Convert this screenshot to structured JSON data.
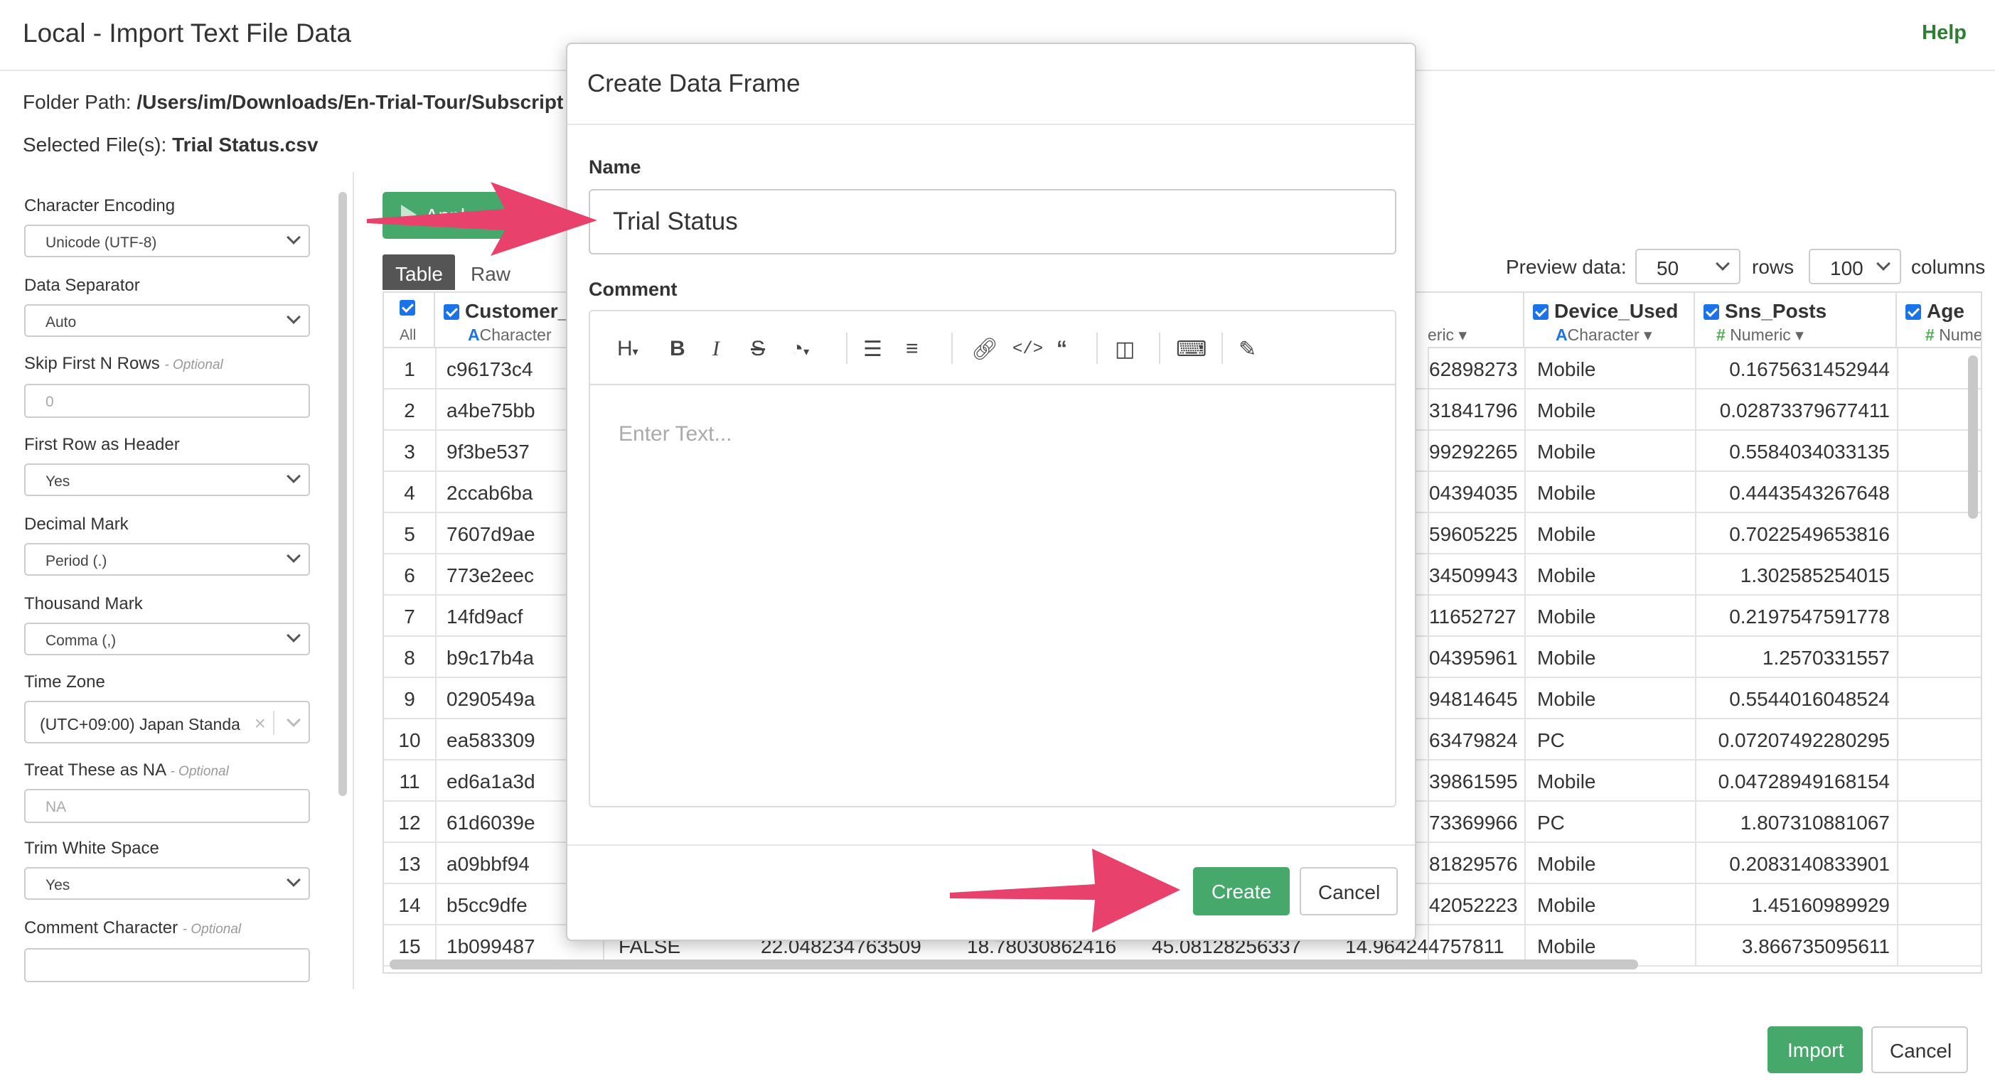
{
  "header": {
    "title": "Local - Import Text File Data",
    "help": "Help"
  },
  "paths": {
    "folder_label": "Folder Path:",
    "folder_value": "/Users/im/Downloads/En-Trial-Tour/Subscript",
    "file_label": "Selected File(s):",
    "file_value": "Trial Status.csv"
  },
  "sidebar": {
    "encoding_label": "Character Encoding",
    "encoding_value": "Unicode (UTF-8)",
    "separator_label": "Data Separator",
    "separator_value": "Auto",
    "skip_label": "Skip First N Rows",
    "skip_optional": "- Optional",
    "skip_placeholder": "0",
    "header_label": "First Row as Header",
    "header_value": "Yes",
    "decimal_label": "Decimal Mark",
    "decimal_value": "Period (.)",
    "thousand_label": "Thousand Mark",
    "thousand_value": "Comma (,)",
    "tz_label": "Time Zone",
    "tz_value": "(UTC+09:00) Japan Standa",
    "na_label": "Treat These as NA",
    "na_optional": "- Optional",
    "na_placeholder": "NA",
    "trim_label": "Trim White Space",
    "trim_value": "Yes",
    "comment_label": "Comment Character",
    "comment_optional": "- Optional"
  },
  "main": {
    "apply_label": "Apply",
    "tabs": [
      "Table",
      "Raw"
    ],
    "preview_label": "Preview data:",
    "preview_rows": "50",
    "rows_label": "rows",
    "preview_cols": "100",
    "cols_label": "columns"
  },
  "grid": {
    "all_label": "All",
    "columns": [
      {
        "name": "Customer_",
        "type": "Character",
        "type_icon": "A"
      },
      {
        "name": "Device_Used",
        "type": "Character",
        "type_icon": "A"
      },
      {
        "name": "Sns_Posts",
        "type": "Numeric",
        "type_icon": "#"
      },
      {
        "name": "Age",
        "type": "Nume",
        "type_icon": "#"
      }
    ],
    "partial_type": "eric",
    "rows": [
      {
        "n": "1",
        "id": "c96173c4",
        "num": "62898273",
        "device": "Mobile",
        "sns": "0.1675631452944"
      },
      {
        "n": "2",
        "id": "a4be75bb",
        "num": "31841796",
        "device": "Mobile",
        "sns": "0.02873379677411"
      },
      {
        "n": "3",
        "id": "9f3be537",
        "num": "99292265",
        "device": "Mobile",
        "sns": "0.5584034033135"
      },
      {
        "n": "4",
        "id": "2ccab6ba",
        "num": "04394035",
        "device": "Mobile",
        "sns": "0.4443543267648"
      },
      {
        "n": "5",
        "id": "7607d9ae",
        "num": "59605225",
        "device": "Mobile",
        "sns": "0.7022549653816"
      },
      {
        "n": "6",
        "id": "773e2eec",
        "num": "34509943",
        "device": "Mobile",
        "sns": "1.302585254015"
      },
      {
        "n": "7",
        "id": "14fd9acf",
        "num": "11652727",
        "device": "Mobile",
        "sns": "0.2197547591778"
      },
      {
        "n": "8",
        "id": "b9c17b4a",
        "num": "04395961",
        "device": "Mobile",
        "sns": "1.2570331557"
      },
      {
        "n": "9",
        "id": "0290549a",
        "num": "94814645",
        "device": "Mobile",
        "sns": "0.5544016048524"
      },
      {
        "n": "10",
        "id": "ea583309",
        "num": "63479824",
        "device": "PC",
        "sns": "0.07207492280295"
      },
      {
        "n": "11",
        "id": "ed6a1a3d",
        "num": "39861595",
        "device": "Mobile",
        "sns": "0.04728949168154"
      },
      {
        "n": "12",
        "id": "61d6039e",
        "num": "73369966",
        "device": "PC",
        "sns": "1.807310881067"
      },
      {
        "n": "13",
        "id": "a09bbf94",
        "num": "81829576",
        "device": "Mobile",
        "sns": "0.2083140833901"
      },
      {
        "n": "14",
        "id": "b5cc9dfe",
        "num": "42052223",
        "device": "Mobile",
        "sns": "1.45160989929"
      }
    ],
    "last_row": {
      "n": "15",
      "id": "1b099487",
      "bool": "FALSE",
      "v1": "22.048234763509",
      "v2": "18.78030862416",
      "v3": "45.08128256337",
      "num": "14.964244757811",
      "device": "Mobile",
      "sns": "3.866735095611"
    }
  },
  "footer": {
    "import_label": "Import",
    "cancel_label": "Cancel"
  },
  "modal": {
    "title": "Create Data Frame",
    "name_label": "Name",
    "name_value": "Trial Status",
    "comment_label": "Comment",
    "comment_placeholder": "Enter Text...",
    "create_label": "Create",
    "cancel_label": "Cancel",
    "toolbar_icons": [
      "heading-icon",
      "bold-icon",
      "italic-icon",
      "strikethrough-icon",
      "color-palette-icon",
      "bullet-list-icon",
      "numbered-list-icon",
      "link-icon",
      "code-icon",
      "quote-icon",
      "columns-icon",
      "keyboard-icon",
      "magic-wand-icon"
    ]
  },
  "colors": {
    "accent_green": "#46a86a",
    "arrow_pink": "#e8416b",
    "checkbox_blue": "#1a73e8"
  }
}
